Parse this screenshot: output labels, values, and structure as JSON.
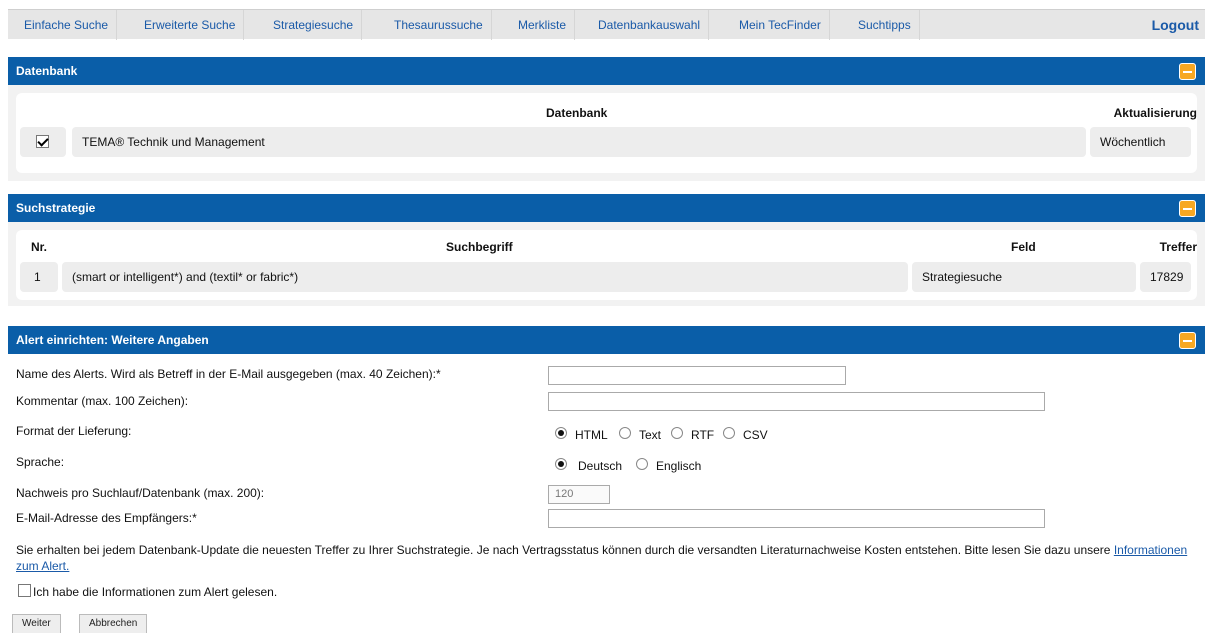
{
  "nav": {
    "items": [
      "Einfache Suche",
      "Erweiterte Suche",
      "Strategiesuche",
      "Thesaurussuche",
      "Merkliste",
      "Datenbankauswahl",
      "Mein TecFinder",
      "Suchtipps"
    ],
    "logout": "Logout"
  },
  "db_panel": {
    "title": "Datenbank",
    "col_db": "Datenbank",
    "col_update": "Aktualisierung",
    "row": {
      "checked": true,
      "name": "TEMA® Technik und Management",
      "update": "Wöchentlich"
    }
  },
  "strategy_panel": {
    "title": "Suchstrategie",
    "col_nr": "Nr.",
    "col_term": "Suchbegriff",
    "col_field": "Feld",
    "col_hits": "Treffer",
    "row": {
      "nr": "1",
      "term": "(smart or intelligent*) and (textil* or fabric*)",
      "field": "Strategiesuche",
      "hits": "17829"
    }
  },
  "alert_panel": {
    "title": "Alert einrichten: Weitere Angaben",
    "name_label": "Name des Alerts. Wird als Betreff in der E-Mail ausgegeben (max. 40 Zeichen):*",
    "name_value": "",
    "comment_label": "Kommentar (max. 100 Zeichen):",
    "comment_value": "",
    "format_label": "Format der Lieferung:",
    "format_options": [
      "HTML",
      "Text",
      "RTF",
      "CSV"
    ],
    "format_selected": "HTML",
    "language_label": "Sprache:",
    "language_options": [
      "Deutsch",
      "Englisch"
    ],
    "language_selected": "Deutsch",
    "results_label": "Nachweis pro Suchlauf/Datenbank (max. 200):",
    "results_value": "120",
    "email_label": "E-Mail-Adresse des Empfängers:*",
    "email_value": "",
    "info_text": "Sie erhalten bei jedem Datenbank-Update die neuesten Treffer zu Ihrer Suchstrategie. Je nach Vertragsstatus können durch die versandten Literaturnachweise Kosten entstehen. Bitte lesen Sie dazu unsere",
    "info_link": "Informationen zum Alert.",
    "ack_label": "Ich habe die Informationen zum Alert gelesen.",
    "ack_checked": false,
    "btn_next": "Weiter",
    "btn_cancel": "Abbrechen"
  },
  "colors": {
    "accent": "#0a5ea8",
    "collapse": "#f7a823",
    "link": "#1a5aa8"
  }
}
